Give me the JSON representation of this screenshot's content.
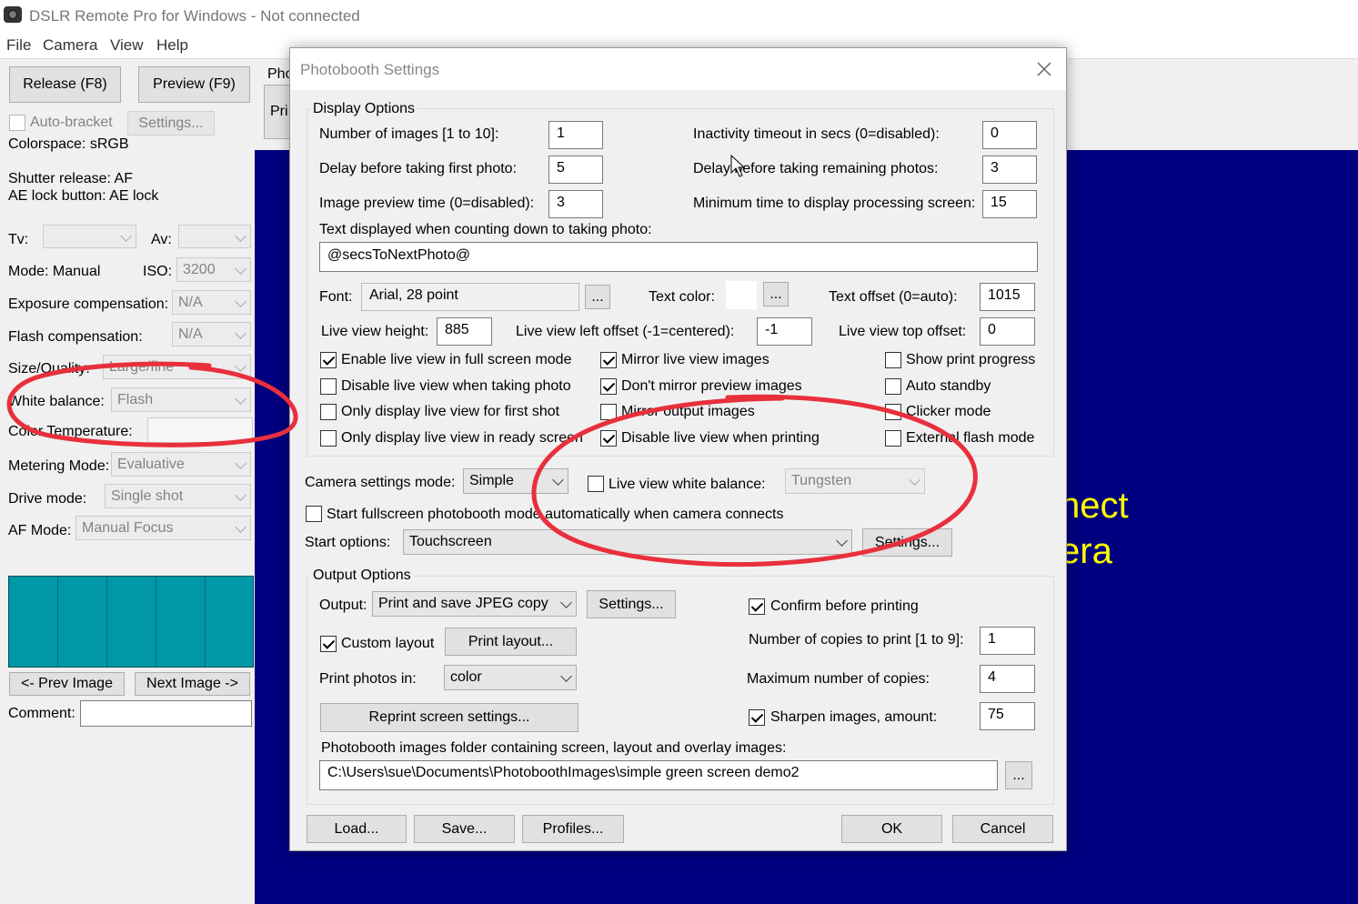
{
  "window": {
    "title": "DSLR Remote Pro for Windows - Not connected"
  },
  "menu": [
    "File",
    "Camera",
    "View",
    "Help"
  ],
  "left": {
    "release": "Release (F8)",
    "preview": "Preview (F9)",
    "autobracket": "Auto-bracket",
    "settings": "Settings...",
    "colorspace": "Colorspace: sRGB",
    "shutter": "Shutter release: AF",
    "aelock": "AE lock button: AE lock",
    "tv": "Tv:",
    "av": "Av:",
    "mode": "Mode: Manual",
    "iso_label": "ISO:",
    "iso": "3200",
    "expcomp_label": "Exposure compensation:",
    "expcomp": "N/A",
    "flashcomp_label": "Flash compensation:",
    "flashcomp": "N/A",
    "size_label": "Size/Quality:",
    "size": "Large/fine",
    "wb_label": "White balance:",
    "wb": "Flash",
    "colortemp_label": "Color Temperature:",
    "metering_label": "Metering Mode:",
    "metering": "Evaluative",
    "drive_label": "Drive mode:",
    "drive": "Single shot",
    "af_label": "AF Mode:",
    "af": "Manual Focus",
    "prev": "<- Prev Image",
    "next": "Next Image ->",
    "comment": "Comment:",
    "tab_partial": "Pho",
    "btn_partial": "Pri"
  },
  "background_text": [
    "nect",
    "era"
  ],
  "dialog": {
    "title": "Photobooth Settings",
    "display_options": "Display Options",
    "num_images_label": "Number of images [1 to 10]:",
    "num_images": "1",
    "inactivity_label": "Inactivity timeout in secs (0=disabled):",
    "inactivity": "0",
    "delay_first_label": "Delay before taking first photo:",
    "delay_first": "5",
    "delay_remaining_label": "Delay before taking remaining photos:",
    "delay_remaining": "3",
    "preview_time_label": "Image preview time (0=disabled):",
    "preview_time": "3",
    "min_processing_label": "Minimum time to display processing screen:",
    "min_processing": "15",
    "countdown_label": "Text displayed when counting down to taking photo:",
    "countdown_text": "@secsToNextPhoto@",
    "font_label": "Font:",
    "font_value": "Arial, 28 point",
    "ellipsis": "...",
    "text_color_label": "Text color:",
    "text_offset_label": "Text offset (0=auto):",
    "text_offset": "1015",
    "lv_height_label": "Live view height:",
    "lv_height": "885",
    "lv_left_label": "Live view left offset (-1=centered):",
    "lv_left": "-1",
    "lv_top_label": "Live view top offset:",
    "lv_top": "0",
    "checks": [
      {
        "label": "Enable live view in full screen mode",
        "checked": true
      },
      {
        "label": "Disable live view when taking photo",
        "checked": false
      },
      {
        "label": "Only display live view for first shot",
        "checked": false
      },
      {
        "label": "Only display live view in ready screen",
        "checked": false
      },
      {
        "label": "Mirror live view images",
        "checked": true
      },
      {
        "label": "Don't mirror preview images",
        "checked": true
      },
      {
        "label": "Mirror output images",
        "checked": false
      },
      {
        "label": "Disable live view when printing",
        "checked": true
      },
      {
        "label": "Show print progress",
        "checked": false
      },
      {
        "label": "Auto standby",
        "checked": false
      },
      {
        "label": "Clicker mode",
        "checked": false
      },
      {
        "label": "External flash mode",
        "checked": false
      }
    ],
    "cam_mode_label": "Camera settings mode:",
    "cam_mode": "Simple",
    "lv_wb_label": "Live view white balance:",
    "lv_wb": "Tungsten",
    "start_fullscreen": "Start fullscreen photobooth mode automatically when camera connects",
    "start_options_label": "Start options:",
    "start_options": "Touchscreen",
    "start_settings": "Settings...",
    "output_options": "Output Options",
    "output_label": "Output:",
    "output": "Print and save JPEG copy",
    "output_settings": "Settings...",
    "confirm_print": "Confirm before printing",
    "custom_layout": "Custom layout",
    "print_layout": "Print layout...",
    "copies_label": "Number of copies to print [1 to 9]:",
    "copies": "1",
    "print_in_label": "Print photos in:",
    "print_in": "color",
    "max_copies_label": "Maximum number of copies:",
    "max_copies": "4",
    "reprint": "Reprint screen settings...",
    "sharpen_label": "Sharpen images, amount:",
    "sharpen": "75",
    "folder_label": "Photobooth images folder containing screen, layout and overlay images:",
    "folder": "C:\\Users\\sue\\Documents\\PhotoboothImages\\simple green screen demo2",
    "load": "Load...",
    "save": "Save...",
    "profiles": "Profiles...",
    "ok": "OK",
    "cancel": "Cancel"
  },
  "colors": {
    "preview_bg": "#000080",
    "thumb": "#0097a7",
    "annotation": "#e8303c",
    "bg_text": "#ffff00"
  }
}
